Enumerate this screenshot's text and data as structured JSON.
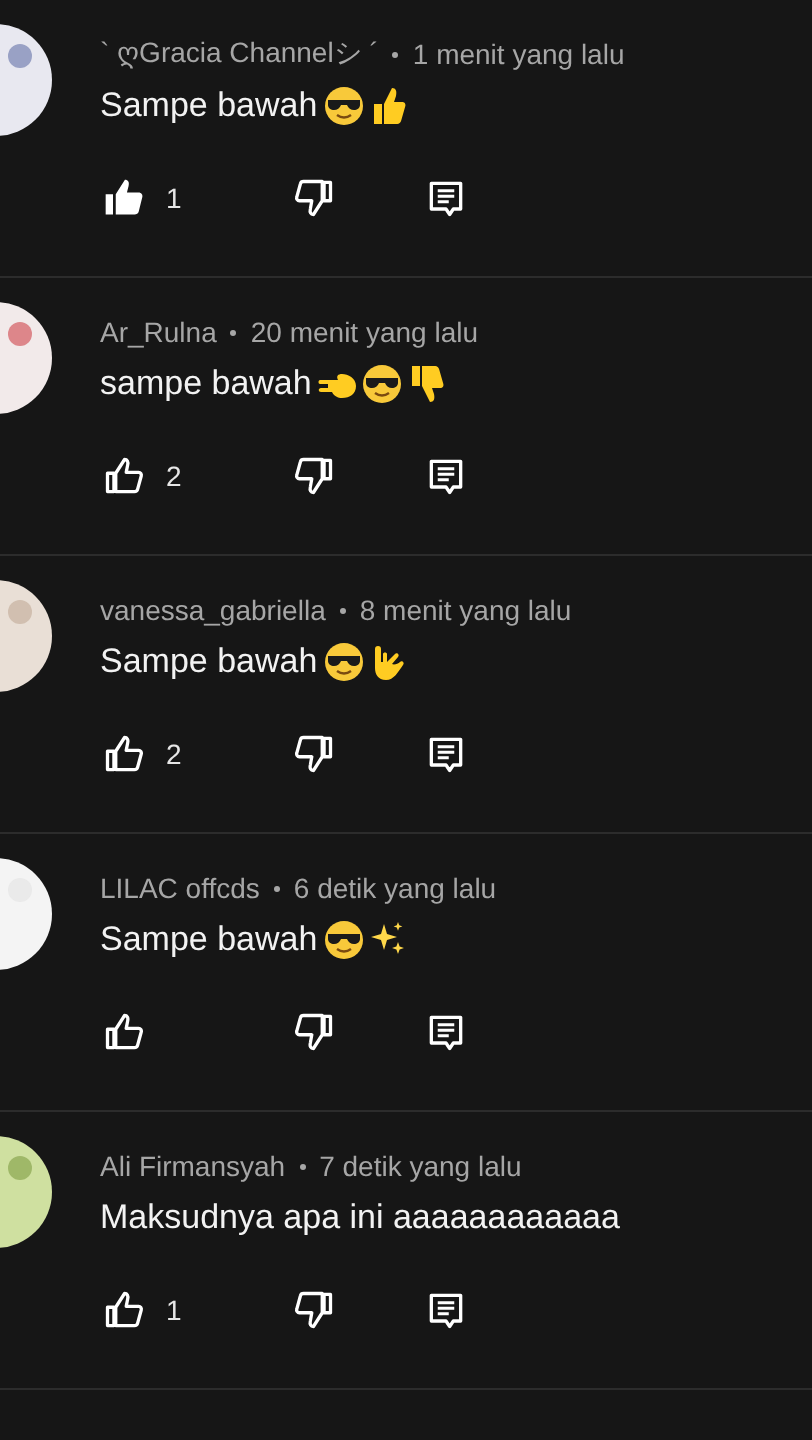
{
  "comments": [
    {
      "author": "` ღGracia Channelシ ´",
      "time": "1 menit yang lalu",
      "text": "Sampe bawah",
      "emojis": [
        {
          "kind": "sunglasses"
        },
        {
          "kind": "thumbs_up"
        }
      ],
      "liked": true,
      "likes": "1",
      "avatar": {
        "kind": "picture"
      }
    },
    {
      "author": "Ar_Rulna",
      "time": "20 menit yang lalu",
      "text": "sampe bawah",
      "emojis": [
        {
          "kind": "point_left"
        },
        {
          "kind": "sunglasses"
        },
        {
          "kind": "thumbs_down"
        }
      ],
      "liked": false,
      "likes": "2",
      "avatar": {
        "kind": "picture"
      }
    },
    {
      "author": "vanessa_gabriella",
      "time": "8 menit yang lalu",
      "text": "Sampe bawah",
      "emojis": [
        {
          "kind": "sunglasses"
        },
        {
          "kind": "love_you_hand"
        }
      ],
      "liked": false,
      "likes": "2",
      "avatar": {
        "kind": "picture"
      }
    },
    {
      "author": "LILAC offcds",
      "time": "6 detik yang lalu",
      "text": "Sampe bawah",
      "emojis": [
        {
          "kind": "sunglasses"
        },
        {
          "kind": "sparkles"
        }
      ],
      "liked": false,
      "avatar": {
        "kind": "picture"
      }
    },
    {
      "author": "Ali Firmansyah",
      "time": "7 detik yang lalu",
      "text": "Maksudnya apa ini aaaaaaaaaaaa",
      "liked": false,
      "likes": "1",
      "avatar": {
        "kind": "picture"
      }
    }
  ]
}
